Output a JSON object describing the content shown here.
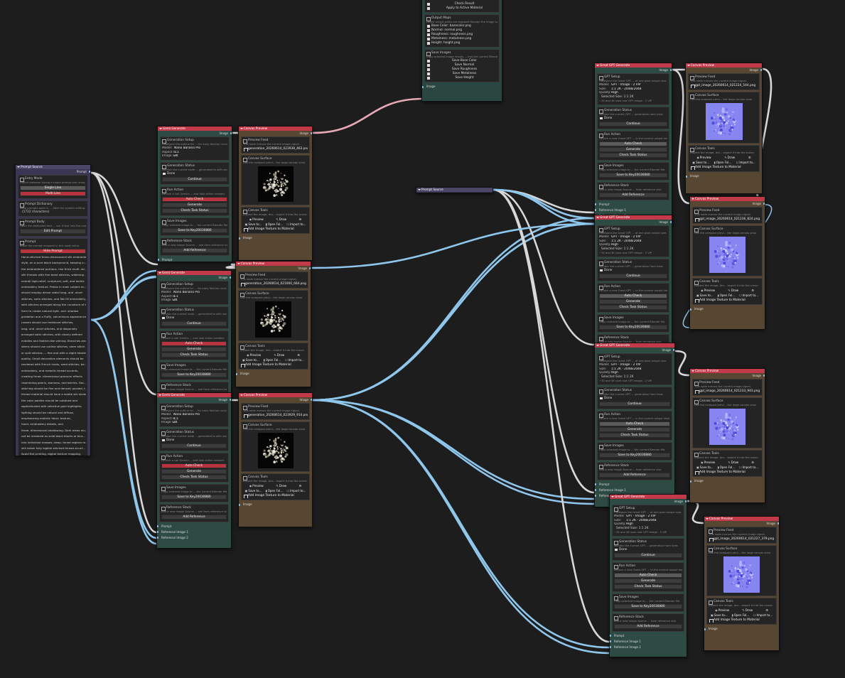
{
  "colors": {
    "canvas": "#1d1d1d",
    "header_red": "#c23a4a",
    "node_green": "#2d4a43",
    "node_brown": "#574632",
    "node_purple": "#3b3651",
    "wire_blue": "#8fc6ec",
    "wire_white": "#d8d8d8",
    "wire_pink": "#e7a9b5"
  },
  "top_node": {
    "btn_check": "Check Result",
    "btn_apply": "Apply to Active Material",
    "outputs_title": "Output Maps",
    "outputs_desc": "Latest output paths are exposed through the image sockets.",
    "outputs": [
      "Base Color: basecolor.png",
      "Normal: normal.png",
      "Roughness: roughness.png",
      "Metalness: metalness.png",
      "Height: height.png"
    ],
    "save_title": "Save Images",
    "save_desc": "Copy selected image results ... into the current Blender file.",
    "save_buttons": [
      "Save Base Color",
      "Save Normal",
      "Save Roughness",
      "Save Metalness",
      "Save Height"
    ],
    "socket": "Image"
  },
  "prompt_source": {
    "title": "Prompt Source",
    "out_prompt": "Prompt",
    "entry_title": "Entry Mode",
    "entry_desc": "Switch between typing a single prompt and using...",
    "single": "Single Line",
    "multi": "Multi Line",
    "dict_title": "Prompt Dictionary",
    "dict_desc": "Keep prompts open in ... After the system editing.",
    "chars": "(1722 characters)",
    "body_title": "Prompt Body",
    "body_desc": "Open the dedicated text ... use it text into the node.",
    "edit": "Edit Prompt",
    "prompt_title": "Prompt",
    "prompt_desc": "Show the prompt wrapped in this node inline.",
    "hide": "Hide Prompt",
    "lines": [
      "Hand-stitched three-dimensional silk embroide...",
      "style, on a pure black background, keeping o...",
      "the embroidered portions. Use thick multi- str...",
      "silk threads with fine band stitches, widening ...",
      "overall high-relief, sculptural, soft, and tactile",
      "embroidery texture. Petals in main subject ar...",
      "should employ dense radial long- and -short",
      "stitches, satin stitches, and flat fill embroidery,",
      "with stitches arranged along the curvature of t...",
      "form to create natural light- and -shadow",
      "gradation and a fluffy, voluminous appearance.",
      "Leaves should use herbivore stitches,",
      "long- and -short stitches, and diagonally",
      "arranged satin stitches, with clearly defined",
      "middles and feather-like veining. Branches and",
      "stems should use outline stitches, stem stitch...",
      "or split stitches --- fine and with a slight twisting",
      "quality. Small decorative elements should be",
      "rendered with French knots, seed stitches, be...",
      "embroidery, and metallic thread accents,",
      "creating three- dimensional granular effects",
      "resembling pearls, stamens, and berries. Dec...",
      "stitching should be fine and densely packed, t...",
      "thread material should have a subtle silk sheen",
      "the color palette should be subdued and",
      "sophisticated with selective gold highlights;",
      "lighting should be natural and diffuse,",
      "emphasizing realistic fabric texture,",
      "hand- embroidery details, and",
      "three- dimensional shadowing. Dark areas mu...",
      "not be rendered as solid black blocks or blur...",
      "into individual masses; deep- toned regions m...",
      "still retain fully legible stitched thread struct...",
      "Avoid flat printing, digital texture mapping,",
      "machine- stitched appearance, and blurred",
      "stitches. Do not alter the original composition,",
      "perspective, structure, or color information ---",
      "generate an embroidery style."
    ]
  },
  "prompt_source_2": {
    "title": "Prompt Source"
  },
  "gemini_nodes": [
    {
      "title": "Gemi Generate",
      "out": "Image",
      "gen_title": "Generation Setup",
      "gen_desc": "Configure the outline for ... for early fashion running.",
      "model_k": "Model:",
      "model_v": "Nano Banana Pro",
      "aspect_k": "Aspect R...",
      "aspect_v": "1:1",
      "size_k": "Image Si...",
      "size_v": "2K",
      "status_title": "Generation Status",
      "status_desc": "Monitor the current node ... generated to with sections.",
      "done": "Done",
      "continue": "Continue",
      "run_title": "Run Action",
      "run_desc": "Launch a call Gemini ... and look action needed.",
      "auto": "Auto Check",
      "generate": "Generate",
      "check": "Check Task Status",
      "save_title": "Save Images",
      "save_desc": "Copy selected image to ... the current Blender file.",
      "save_btn": "Save to Key20030880",
      "ref_title": "Reference Stack",
      "ref_desc": "Add a new image Source ... see from reference slot.",
      "add_ref": "Add Reference",
      "in_prompt": "Prompt",
      "in_ref1": "Reference Image 1",
      "in_ref2": "Reference Image 2"
    },
    {
      "title": "Gemi Generate",
      "out": "Image",
      "gen_title": "Generation Setup",
      "gen_desc": "Configure the outline for ... for early fashion running.",
      "model_k": "Model:",
      "model_v": "Nano Banana Pro",
      "aspect_k": "Aspect R...",
      "aspect_v": "1:1",
      "size_k": "Image Si...",
      "size_v": "2K",
      "status_title": "Generation Status",
      "status_desc": "Monitor the current node ... generated to with sections.",
      "done": "Done",
      "continue": "Continue",
      "run_title": "Run Action",
      "run_desc": "Launch a call Gemini ... and look action needed.",
      "auto": "Auto Check",
      "generate": "Generate",
      "check": "Check Task Status",
      "save_title": "Save Images",
      "save_desc": "Copy selected image to ... the current Blender file.",
      "save_btn": "Save to Key20030880",
      "ref_title": "Reference Stack",
      "ref_desc": "Add a new image Source ... see from reference slot.",
      "add_ref": "Add Reference",
      "in_prompt": "Prompt",
      "in_ref1": "Reference Image 1",
      "in_ref2": "Reference Image 2"
    },
    {
      "title": "Gemi Generate",
      "out": "Image",
      "gen_title": "Generation Setup",
      "gen_desc": "Configure the outline for ... for early fashion running.",
      "model_k": "Model:",
      "model_v": "Nano Banana Pro",
      "aspect_k": "Aspect R...",
      "aspect_v": "1:1",
      "size_k": "Image Si...",
      "size_v": "2K",
      "status_title": "Generation Status",
      "status_desc": "Monitor the current node ... generated to with sections.",
      "done": "Done",
      "continue": "Continue",
      "run_title": "Run Action",
      "run_desc": "Launch a call Gemini ... and look action needed.",
      "auto": "Auto Check",
      "generate": "Generate",
      "check": "Check Task Status",
      "save_title": "Save Images",
      "save_desc": "Copy selected image to ... the current Blender file.",
      "save_btn": "Save to Key20030880",
      "ref_title": "Reference Stack",
      "ref_desc": "Add a new image Source ... see from reference slot.",
      "add_ref": "Add Reference",
      "in_prompt": "Prompt",
      "in_ref1": "Reference Image 1",
      "in_ref2": "Reference Image 2"
    }
  ],
  "gpt_nodes": [
    {
      "title": "Great GPT Generate",
      "out": "Image",
      "gen_title": "GPT Setup",
      "gen_desc": "Configure the Great GPT ... of and pixel output size.",
      "model_k": "Model:",
      "model_v": "GPT - Image - 2 VIP",
      "size_k": "Size:",
      "size_v": "1:1 2K - 2048x2048",
      "q_k": "Quality:",
      "q_v": "High",
      "sel": "Selected Size: 1:1 2K",
      "sel2": "~34 and 4K uses size GPT Image - 2 VIP",
      "status_title": "Generation Status",
      "status_desc": "Monitor the current GPT ... generation from here.",
      "done": "Done",
      "continue": "Continue",
      "run_title": "Run Action",
      "run_desc": "Launch a new Great GPT ... in the current output task.",
      "auto": "Auto Check",
      "generate": "Generate",
      "check": "Check Task Status",
      "save_title": "Save Images",
      "save_desc": "Copy selected image to ... the current Blender file.",
      "save_btn": "Save to Key20030880",
      "ref_title": "Reference Stack",
      "ref_desc": "Add a new image Source ... from reference slot.",
      "add_ref": "Add Reference",
      "in_prompt": "Prompt",
      "in_ref1": "Reference Image 1",
      "in_ref2": "Reference Image 2"
    },
    {
      "title": "Great GPT Generate",
      "out": "Image",
      "gen_title": "GPT Setup",
      "gen_desc": "Configure the Great GPT ... of and pixel output size.",
      "model_k": "Model:",
      "model_v": "GPT - Image - 2 VIP",
      "size_k": "Size:",
      "size_v": "1:1 2K - 2048x2048",
      "q_k": "Quality:",
      "q_v": "High",
      "sel": "Selected Size: 1:1 2K",
      "sel2": "~34 and 4K uses size GPT Image - 2 VIP",
      "status_title": "Generation Status",
      "status_desc": "Monitor the current GPT ... generation from here.",
      "done": "Done",
      "continue": "Continue",
      "run_title": "Run Action",
      "run_desc": "Launch a new Great GPT ... in the current output task.",
      "auto": "Auto Check",
      "generate": "Generate",
      "check": "Check Task Status",
      "save_title": "Save Images",
      "save_desc": "Copy selected image to ... the current Blender file.",
      "save_btn": "Save to Key20030880",
      "ref_title": "Reference Stack",
      "ref_desc": "Add a new image Source ... from reference slot.",
      "add_ref": "Add Reference",
      "in_prompt": "Prompt",
      "in_ref1": "Reference Image 1",
      "in_ref2": "Reference Image 2"
    },
    {
      "title": "Great GPT Generate",
      "out": "Image",
      "gen_title": "GPT Setup",
      "gen_desc": "Configure the Great GPT ... of and pixel output size.",
      "model_k": "Model:",
      "model_v": "GPT - Image - 2 VIP",
      "size_k": "Size:",
      "size_v": "1:1 2K - 2048x2048",
      "q_k": "Quality:",
      "q_v": "High",
      "sel": "Selected Size: 1:1 2K",
      "sel2": "~34 and 4K uses size GPT Image - 2 VIP",
      "status_title": "Generation Status",
      "status_desc": "Monitor the current GPT ... generation from here.",
      "done": "Done",
      "continue": "Continue",
      "run_title": "Run Action",
      "run_desc": "Launch a new Great GPT ... in the current output task.",
      "auto": "Auto Check",
      "generate": "Generate",
      "check": "Check Task Status",
      "save_title": "Save Images",
      "save_desc": "Copy selected image to ... the current Blender file.",
      "save_btn": "Save to Key20030880",
      "ref_title": "Reference Stack",
      "ref_desc": "Add a new image Source ... from reference slot.",
      "add_ref": "Add Reference",
      "in_prompt": "Prompt",
      "in_ref1": "Reference Image 1",
      "in_ref2": "Reference Image 2"
    },
    {
      "title": "Great GPT Generate",
      "out": "Image",
      "gen_title": "GPT Setup",
      "gen_desc": "Configure the Great GPT ... of and pixel output size.",
      "model_k": "Model:",
      "model_v": "GPT - Image - 2 VIP",
      "size_k": "Size:",
      "size_v": "1:1 2K - 2048x2048",
      "q_k": "Quality:",
      "q_v": "High",
      "sel": "Selected Size: 1:1 2K",
      "sel2": "~34 and 4K uses size GPT Image - 2 VIP",
      "status_title": "Generation Status",
      "status_desc": "Monitor the current GPT ... generation from here.",
      "done": "Done",
      "continue": "Continue",
      "run_title": "Run Action",
      "run_desc": "Launch a new Great GPT ... in the current output task.",
      "auto": "Auto Check",
      "generate": "Generate",
      "check": "Check Task Status",
      "save_title": "Save Images",
      "save_desc": "Copy selected image to ... the current Blender file.",
      "save_btn": "Save to Key20030880",
      "ref_title": "Reference Stack",
      "ref_desc": "Add a new image Source ... from reference slot.",
      "add_ref": "Add Reference",
      "in_prompt": "Prompt",
      "in_ref1": "Reference Image 1",
      "in_ref2": "Reference Image 2"
    }
  ],
  "preview_nodes": [
    {
      "title": "Canvas Preview",
      "out": "Image",
      "feed_title": "Preview Feed",
      "feed_desc": "This node mirrors the current image signal.",
      "file": "generation_20260614_023938_463.png",
      "surf_title": "Canvas Surface",
      "surf_desc": "Use the compact previ... the large canvas view.",
      "tools_title": "Canvas Tools",
      "tools_desc": "Inspect the image, dra... export it into the scene.",
      "preview": "Preview",
      "draw": "Draw",
      "save": "Save to...",
      "open": "Open Fol...",
      "import": "Import to...",
      "add_tex": "Add Image Texture to Material",
      "in": "Image"
    },
    {
      "title": "Canvas Preview",
      "out": "Image",
      "feed_title": "Preview Feed",
      "feed_desc": "This node mirrors the current image signal.",
      "file": "generation_20260614_021000_664.png",
      "surf_title": "Canvas Surface",
      "surf_desc": "Use the compact previ... the large canvas view.",
      "tools_title": "Canvas Tools",
      "tools_desc": "Inspect the image, dra... export it into the scene.",
      "preview": "Preview",
      "draw": "Draw",
      "save": "Save to...",
      "open": "Open Fol...",
      "import": "Import to...",
      "add_tex": "Add Image Texture to Material",
      "in": "Image"
    },
    {
      "title": "Canvas Preview",
      "out": "Image",
      "feed_title": "Preview Feed",
      "feed_desc": "This node mirrors the current image signal.",
      "file": "generation_20260614_023929_914.png",
      "surf_title": "Canvas Surface",
      "surf_desc": "Use the compact previ... the large canvas view.",
      "tools_title": "Canvas Tools",
      "tools_desc": "Inspect the image, dra... export it into the scene.",
      "preview": "Preview",
      "draw": "Draw",
      "save": "Save to...",
      "open": "Open Fol...",
      "import": "Import to...",
      "add_tex": "Add Image Texture to Material",
      "in": "Image"
    },
    {
      "title": "Canvas Preview",
      "out": "Image",
      "feed_title": "Preview Feed",
      "feed_desc": "This node mirrors the current image signal.",
      "file": "gpt_image_20260614_021224_544.png",
      "surf_title": "Canvas Surface",
      "surf_desc": "Use the compact previ... the large canvas view.",
      "tools_title": "Canvas Tools",
      "tools_desc": "Inspect the image, dra... export it into the scene.",
      "preview": "Preview",
      "draw": "Draw",
      "save": "Save to...",
      "open": "Open Fol...",
      "import": "Import to...",
      "add_tex": "Add Image Texture to Material",
      "in": "Image"
    },
    {
      "title": "Canvas Preview",
      "out": "Image",
      "feed_title": "Preview Feed",
      "feed_desc": "This node mirrors the current image signal.",
      "file": "gpt_image_20260614_021236_824.png",
      "surf_title": "Canvas Surface",
      "surf_desc": "Use the compact previ... the large canvas view.",
      "tools_title": "Canvas Tools",
      "tools_desc": "Inspect the image, dra... export it into the scene.",
      "preview": "Preview",
      "draw": "Draw",
      "save": "Save to...",
      "open": "Open Fol...",
      "import": "Import to...",
      "add_tex": "Add Image Texture to Material",
      "in": "Image"
    },
    {
      "title": "Canvas Preview",
      "out": "Image",
      "feed_title": "Preview Feed",
      "feed_desc": "This node mirrors the current image signal.",
      "file": "gpt_image_20260614_021233_943.png",
      "surf_title": "Canvas Surface",
      "surf_desc": "Use the compact previ... the large canvas view.",
      "tools_title": "Canvas Tools",
      "tools_desc": "Inspect the image, dra... export it into the scene.",
      "preview": "Preview",
      "draw": "Draw",
      "save": "Save to...",
      "open": "Open Fol...",
      "import": "Import to...",
      "add_tex": "Add Image Texture to Material",
      "in": "Image"
    },
    {
      "title": "Canvas Preview",
      "out": "Image",
      "feed_title": "Preview Feed",
      "feed_desc": "This node mirrors the current image signal.",
      "file": "gpt_image_20260614_021227_379.png",
      "surf_title": "Canvas Surface",
      "surf_desc": "Use the compact previ... the large canvas view.",
      "tools_title": "Canvas Tools",
      "tools_desc": "Inspect the image, dra... export it into the scene.",
      "preview": "Preview",
      "draw": "Draw",
      "save": "Save to...",
      "open": "Open Fol...",
      "import": "Import to...",
      "add_tex": "Add Image Texture to Material",
      "in": "Image"
    }
  ]
}
